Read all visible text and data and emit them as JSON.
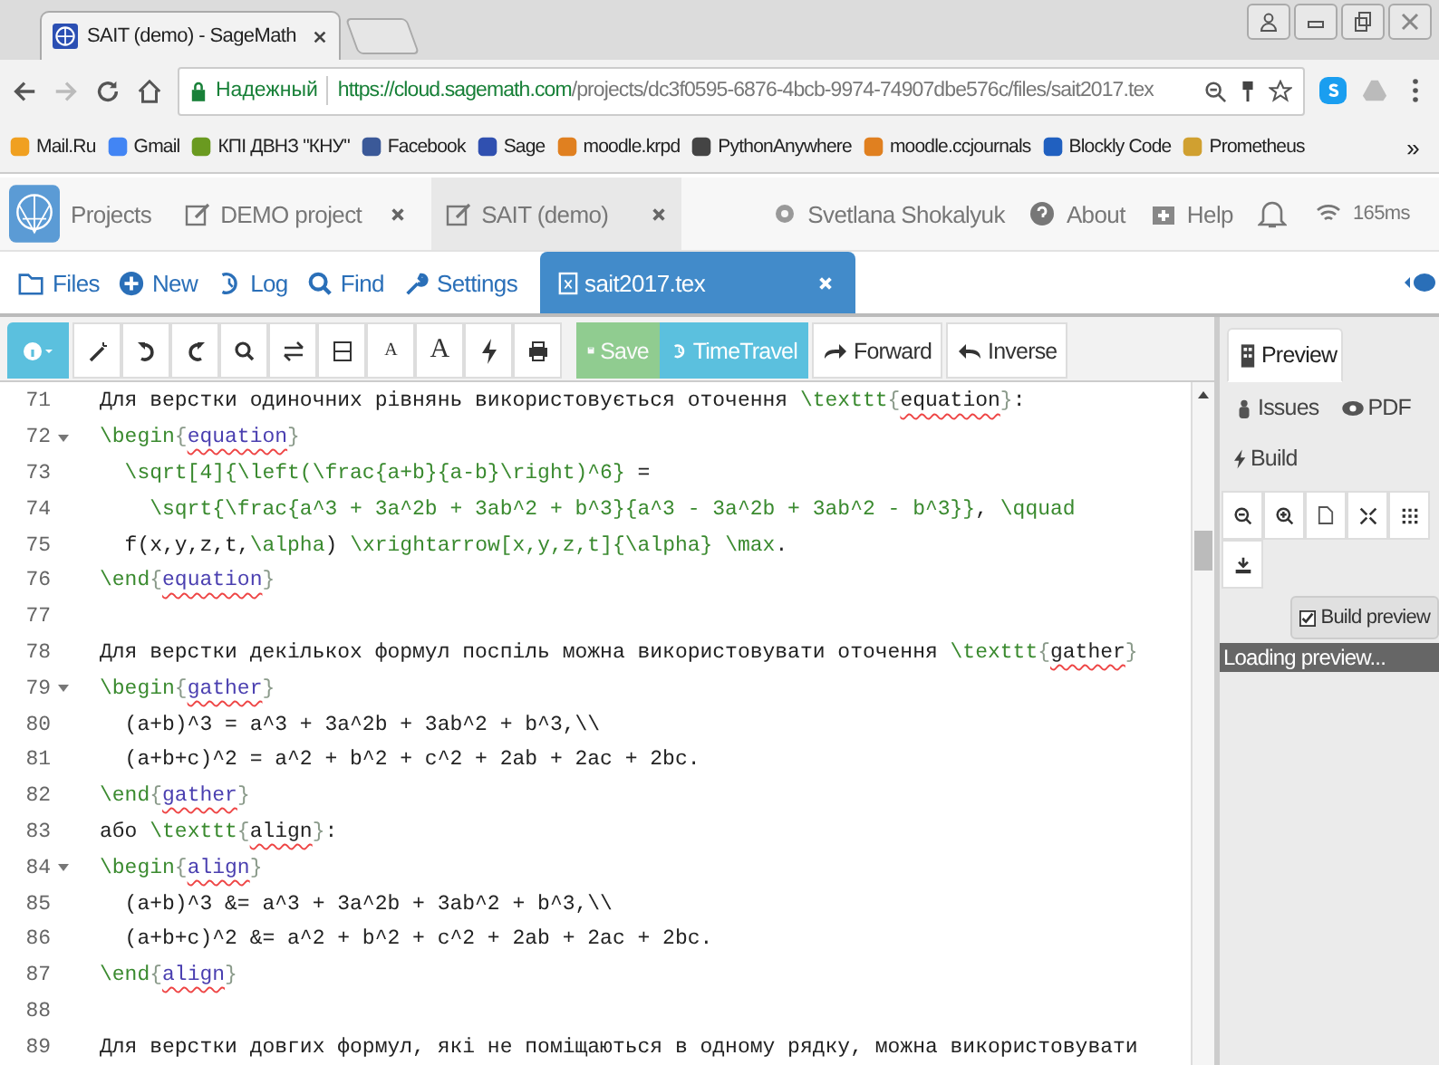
{
  "browser": {
    "tab_title": "SAIT (demo) - SageMath",
    "secure_label": "Надежный",
    "url_host": "https://cloud.sagemath.com",
    "url_path": "/projects/dc3f0595-6876-4bcb-9974-74907dbe576c/files/sait2017.tex",
    "bookmarks": [
      "Mail.Ru",
      "Gmail",
      "КПІ ДВНЗ \"КНУ\"",
      "Facebook",
      "Sage",
      "moodle.krpd",
      "PythonAnywhere",
      "moodle.ccjournals",
      "Blockly Code",
      "Prometheus"
    ],
    "more": "»"
  },
  "nav": {
    "projects": "Projects",
    "tabs": [
      {
        "label": "DEMO project",
        "selected": false
      },
      {
        "label": "SAIT (demo)",
        "selected": true
      }
    ],
    "user": "Svetlana Shokalyuk",
    "about": "About",
    "help": "Help",
    "ping": "165ms"
  },
  "filebar": {
    "items": [
      "Files",
      "New",
      "Log",
      "Find",
      "Settings"
    ],
    "file_tab": "sait2017.tex"
  },
  "toolbar": {
    "font_buttons": [
      {
        "label": "A",
        "kind": "small"
      },
      {
        "label": "A",
        "kind": "large"
      }
    ],
    "save": {
      "label": "Save",
      "disabled": true
    },
    "timetravel": "TimeTravel",
    "forward": "Forward",
    "inverse": "Inverse"
  },
  "editor": {
    "lines": [
      {
        "number": "71",
        "segments": [
          {
            "kind": "text",
            "text": "Для верстки одиночних рівнянь використовується оточення "
          },
          {
            "kind": "cmd",
            "text": "\\texttt"
          },
          {
            "kind": "brace",
            "text": "{"
          },
          {
            "kind": "flagged",
            "text": "equation"
          },
          {
            "kind": "brace",
            "text": "}"
          },
          {
            "kind": "text",
            "text": ":"
          }
        ]
      },
      {
        "number": "72",
        "fold": true,
        "segments": [
          {
            "kind": "cmd",
            "text": "\\begin"
          },
          {
            "kind": "brace",
            "text": "{"
          },
          {
            "kind": "env",
            "text": "equation"
          },
          {
            "kind": "brace",
            "text": "}"
          }
        ]
      },
      {
        "number": "73",
        "segments": [
          {
            "kind": "cmd",
            "text": "  \\sqrt[4]{\\left(\\frac{a+b}{a-b}\\right)^6}"
          },
          {
            "kind": "text",
            "text": " ="
          }
        ]
      },
      {
        "number": "74",
        "segments": [
          {
            "kind": "cmd",
            "text": "    \\sqrt{\\frac{a^3 + 3a^2b + 3ab^2 + b^3}{a^3 - 3a^2b + 3ab^2 - b^3}}"
          },
          {
            "kind": "text",
            "text": ", "
          },
          {
            "kind": "cmd",
            "text": "\\qquad"
          }
        ]
      },
      {
        "number": "75",
        "segments": [
          {
            "kind": "text",
            "text": "  f(x,y,z,t,"
          },
          {
            "kind": "cmd",
            "text": "\\alpha"
          },
          {
            "kind": "text",
            "text": ") "
          },
          {
            "kind": "cmd",
            "text": "\\xrightarrow[x,y,z,t]{\\alpha} \\max"
          },
          {
            "kind": "text",
            "text": "."
          }
        ]
      },
      {
        "number": "76",
        "segments": [
          {
            "kind": "cmd",
            "text": "\\end"
          },
          {
            "kind": "brace",
            "text": "{"
          },
          {
            "kind": "env",
            "text": "equation"
          },
          {
            "kind": "brace",
            "text": "}"
          }
        ]
      },
      {
        "number": "77"
      },
      {
        "number": "78",
        "segments": [
          {
            "kind": "text",
            "text": "Для верстки декількох формул поспіль можна використовувати оточення "
          },
          {
            "kind": "cmd",
            "text": "\\texttt"
          },
          {
            "kind": "brace",
            "text": "{"
          },
          {
            "kind": "flagged",
            "text": "gather"
          },
          {
            "kind": "brace",
            "text": "}"
          }
        ]
      },
      {
        "number": "79",
        "fold": true,
        "segments": [
          {
            "kind": "cmd",
            "text": "\\begin"
          },
          {
            "kind": "brace",
            "text": "{"
          },
          {
            "kind": "env",
            "text": "gather"
          },
          {
            "kind": "brace",
            "text": "}"
          }
        ]
      },
      {
        "number": "80",
        "segments": [
          {
            "kind": "text",
            "text": "  (a+b)^3 = a^3 + 3a^2b + 3ab^2 + b^3,\\\\"
          }
        ]
      },
      {
        "number": "81",
        "segments": [
          {
            "kind": "text",
            "text": "  (a+b+c)^2 = a^2 + b^2 + c^2 + 2ab + 2ac + 2bc."
          }
        ]
      },
      {
        "number": "82",
        "segments": [
          {
            "kind": "cmd",
            "text": "\\end"
          },
          {
            "kind": "brace",
            "text": "{"
          },
          {
            "kind": "env",
            "text": "gather"
          },
          {
            "kind": "brace",
            "text": "}"
          }
        ]
      },
      {
        "number": "83",
        "segments": [
          {
            "kind": "text",
            "text": "або "
          },
          {
            "kind": "cmd",
            "text": "\\texttt"
          },
          {
            "kind": "brace",
            "text": "{"
          },
          {
            "kind": "flagged",
            "text": "align"
          },
          {
            "kind": "brace",
            "text": "}"
          },
          {
            "kind": "text",
            "text": ":"
          }
        ]
      },
      {
        "number": "84",
        "fold": true,
        "segments": [
          {
            "kind": "cmd",
            "text": "\\begin"
          },
          {
            "kind": "brace",
            "text": "{"
          },
          {
            "kind": "env",
            "text": "align"
          },
          {
            "kind": "brace",
            "text": "}"
          }
        ]
      },
      {
        "number": "85",
        "segments": [
          {
            "kind": "text",
            "text": "  (a+b)^3 &= a^3 + 3a^2b + 3ab^2 + b^3,\\\\"
          }
        ]
      },
      {
        "number": "86",
        "segments": [
          {
            "kind": "text",
            "text": "  (a+b+c)^2 &= a^2 + b^2 + c^2 + 2ab + 2ac + 2bc."
          }
        ]
      },
      {
        "number": "87",
        "segments": [
          {
            "kind": "cmd",
            "text": "\\end"
          },
          {
            "kind": "brace",
            "text": "{"
          },
          {
            "kind": "env",
            "text": "align"
          },
          {
            "kind": "brace",
            "text": "}"
          }
        ]
      },
      {
        "number": "88"
      },
      {
        "number": "89",
        "segments": [
          {
            "kind": "text",
            "text": "Для верстки довгих формул, які не поміщаються в одному рядку, можна використовувати"
          }
        ]
      }
    ]
  },
  "preview": {
    "tabs": [
      {
        "label": "Preview",
        "selected": true
      }
    ],
    "issues": "Issues",
    "pdf": "PDF",
    "build": "Build",
    "build_preview": {
      "label": "Build preview",
      "checked": true
    },
    "status": "Loading preview..."
  }
}
